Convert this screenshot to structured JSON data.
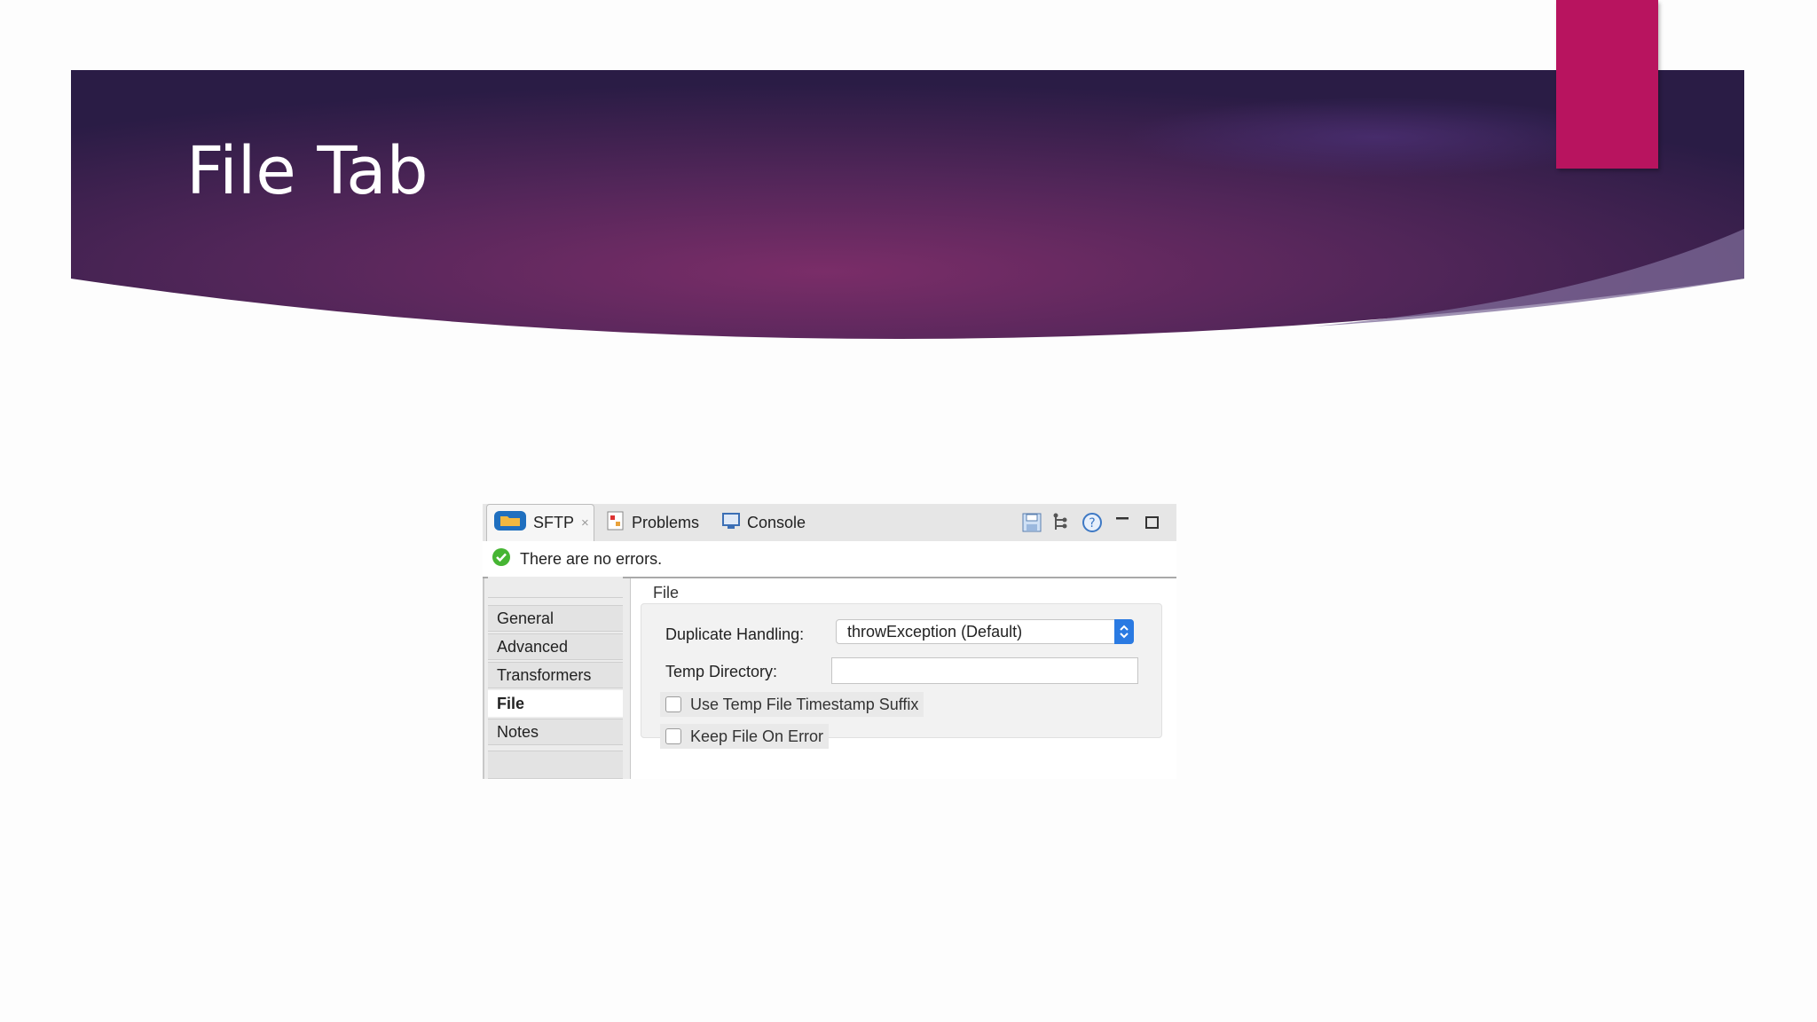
{
  "slide": {
    "title": "File Tab",
    "accent_color": "#b8145f",
    "banner_colors": [
      "#2b1d48",
      "#6a2a63",
      "#3d2357"
    ]
  },
  "panel": {
    "tabs": [
      {
        "label": "SFTP",
        "icon": "folder-icon",
        "active": true,
        "closable": true
      },
      {
        "label": "Problems",
        "icon": "problems-icon",
        "active": false
      },
      {
        "label": "Console",
        "icon": "console-icon",
        "active": false
      }
    ],
    "close_glyph": "×",
    "toolbar_icons": [
      "save-icon",
      "tree-icon",
      "help-icon",
      "minimize-icon",
      "maximize-icon"
    ],
    "status": {
      "text": "There are no errors.",
      "icon": "check-circle-icon"
    },
    "nav": {
      "items": [
        {
          "label": "General",
          "selected": false
        },
        {
          "label": "Advanced",
          "selected": false
        },
        {
          "label": "Transformers",
          "selected": false
        },
        {
          "label": "File",
          "selected": true
        },
        {
          "label": "Notes",
          "selected": false
        }
      ]
    },
    "content": {
      "heading": "File",
      "duplicate_label": "Duplicate Handling:",
      "duplicate_value": "throwException (Default)",
      "temp_dir_label": "Temp Directory:",
      "temp_dir_value": "",
      "checkbox_timestamp": "Use Temp File Timestamp Suffix",
      "checkbox_keep": "Keep File On Error"
    }
  }
}
